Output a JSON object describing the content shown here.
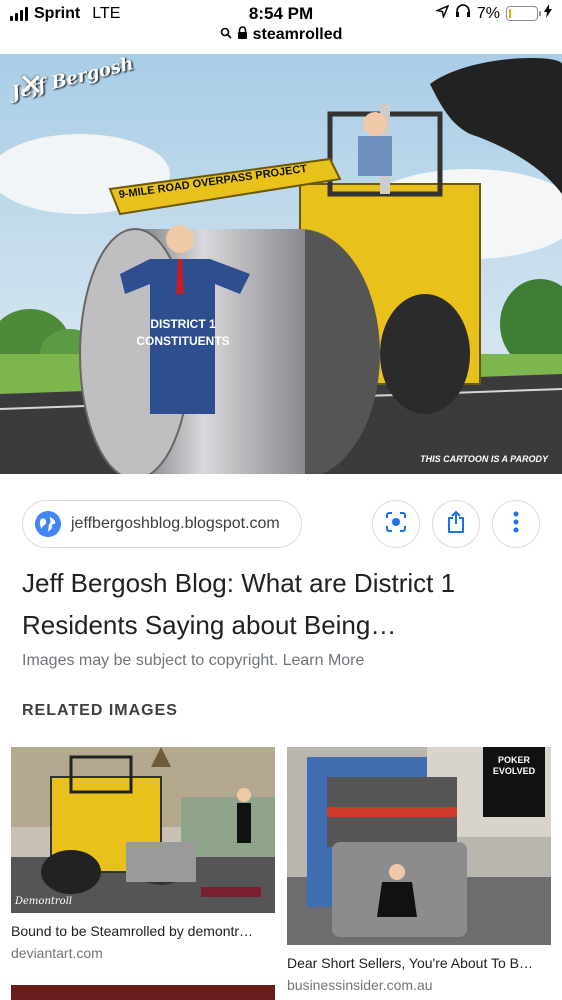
{
  "status": {
    "carrier": "Sprint",
    "network": "LTE",
    "time": "8:54 PM",
    "battery": "7%",
    "battery_level": 0.07
  },
  "address": {
    "query": "steamrolled"
  },
  "hero": {
    "logo_text": "Jeff Bergosh",
    "banner_text": "9-MILE ROAD OVERPASS PROJECT",
    "figure_text_line1": "DISTRICT 1",
    "figure_text_line2": "CONSTITUENTS",
    "parody_text": "THIS CARTOON IS A PARODY"
  },
  "result": {
    "source_domain": "jeffbergoshblog.blogspot.com",
    "title_line1": "Jeff Bergosh Blog: What are District 1",
    "title_line2": "Residents Saying about Being…",
    "copyright_text": "Images may be subject to copyright.",
    "learn_more": "Learn More"
  },
  "related": {
    "heading": "RELATED IMAGES",
    "items": [
      {
        "caption": "Bound to be Steamrolled by demontr…",
        "domain": "deviantart.com",
        "watermark": "Demontroll"
      },
      {
        "caption": "Dear Short Sellers, You're About To B…",
        "domain": "businessinsider.com.au",
        "sign_text": "POKER EVOLVED"
      }
    ]
  },
  "colors": {
    "roller_yellow": "#e8c21a",
    "suit_blue": "#2f4e8f",
    "link_blue": "#1a73e8",
    "battery_low": "#e0b400"
  }
}
